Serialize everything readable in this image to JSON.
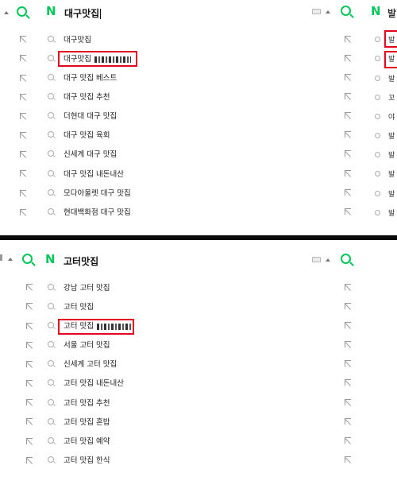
{
  "top": {
    "query": "대구맛집",
    "suggestions": [
      "대구맛집",
      "대구맛집",
      "대구 맛집 베스트",
      "대구 맛집 추천",
      "더현대 대구 맛집",
      "대구 맛집 육회",
      "신세계 대구 맛집",
      "대구 맛집 내돈내산",
      "모다아울렛 대구 맛집",
      "현대백화점 대구 맛집"
    ],
    "right_edge_chars": [
      "발",
      "발",
      "발",
      "꼬",
      "야",
      "발",
      "발",
      "발",
      "발",
      "발"
    ]
  },
  "bottom": {
    "query": "고터맛집",
    "suggestions": [
      "강남 고터 맛집",
      "고터 맛집",
      "고터 맛집",
      "서울 고터 맛집",
      "신세계 고터 맛집",
      "고터 맛집 내돈내산",
      "고터 맛집 추천",
      "고터 맛집 혼밥",
      "고터 맛집 예약",
      "고터 맛집 한식"
    ]
  },
  "brand": {
    "logo_letter": "N",
    "accent": "#03c75a",
    "highlight": "#e4061f"
  }
}
